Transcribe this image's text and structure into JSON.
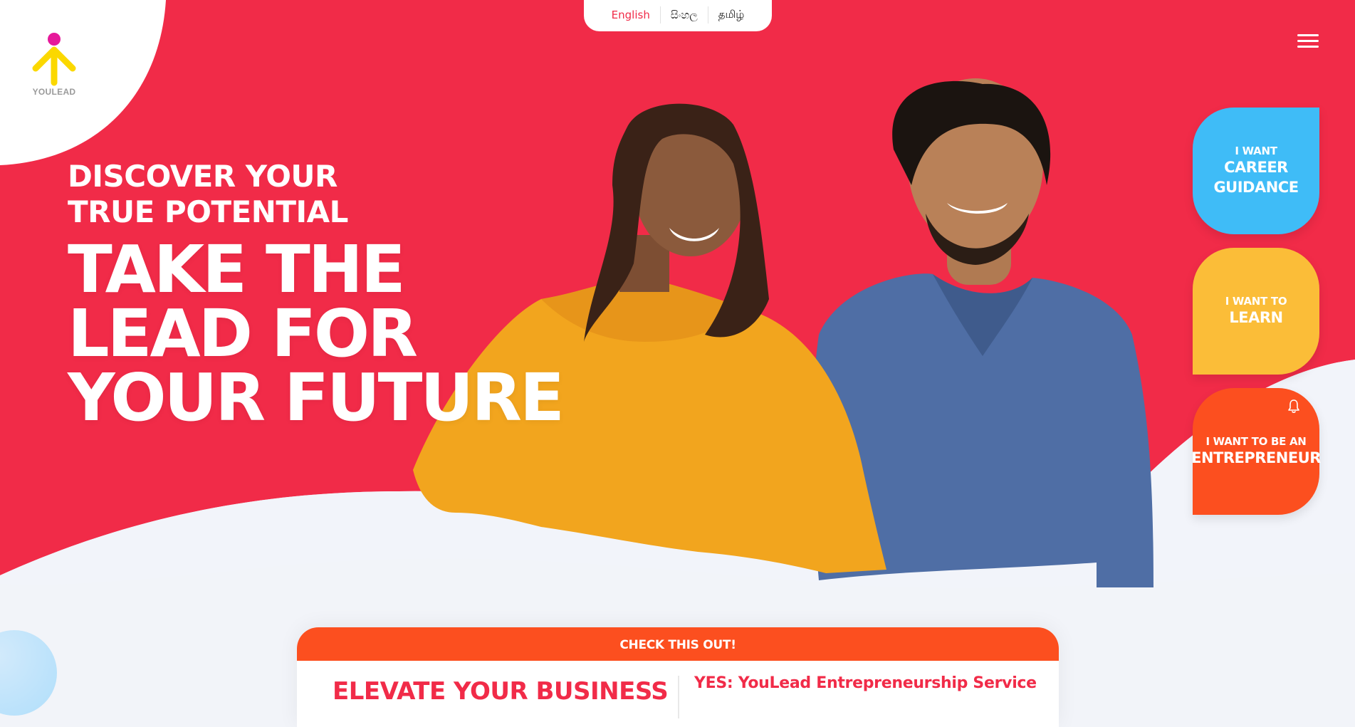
{
  "brand": {
    "logo_text": "YOULEAD",
    "colors": {
      "hero_red": "#f12b48",
      "career_blue": "#3fbcf7",
      "learn_yellow": "#fbbd38",
      "entrepreneur_orange": "#fc4f1f",
      "logo_dot": "#e6199a",
      "logo_arrow": "#fbd800"
    }
  },
  "language_switcher": {
    "items": [
      {
        "label": "English",
        "active": true
      },
      {
        "label": "සිංහල",
        "active": false
      },
      {
        "label": "தமிழ்",
        "active": false
      }
    ]
  },
  "menu": {
    "icon": "hamburger-menu-icon"
  },
  "hero": {
    "subheadline_line1": "DISCOVER YOUR",
    "subheadline_line2": "TRUE POTENTIAL",
    "headline_line1": "TAKE THE",
    "headline_line2": "LEAD FOR",
    "headline_line3": "YOUR FUTURE"
  },
  "cta_cards": [
    {
      "small": "I WANT",
      "big_line1": "CAREER",
      "big_line2": "GUIDANCE"
    },
    {
      "small": "I WANT TO",
      "big_line1": "LEARN"
    },
    {
      "small": "I WANT TO BE AN",
      "big_line1": "ENTREPRENEUR",
      "icon": "bell-icon"
    }
  ],
  "promo": {
    "header": "CHECK THIS OUT!",
    "left_title": "ELEVATE YOUR BUSINESS",
    "right_title": "YES: YouLead Entrepreneurship Service"
  }
}
